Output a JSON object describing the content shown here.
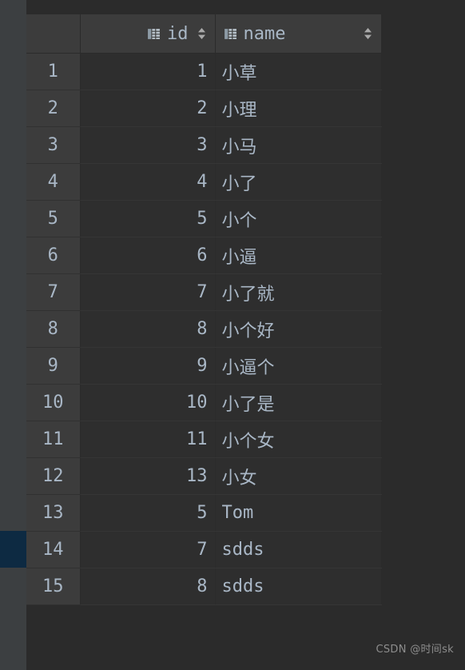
{
  "theme": {
    "window_bg": "#2b2b2b",
    "gutter_bg": "#3c3f41",
    "gutter_marker_bg": "#0d2a42",
    "header_bg": "#3c3c3c",
    "cell_bg": "#2e2e2e",
    "rownum_bg": "#3c3c3c",
    "text_color": "#a9b7c6",
    "grid_line": "#353535",
    "watermark_color": "#8d8d8d"
  },
  "table": {
    "columns": [
      {
        "key": "rownum",
        "label": "",
        "icon": "",
        "sortable": false,
        "align": "center"
      },
      {
        "key": "id",
        "label": "id",
        "icon": "table-column-icon",
        "sortable": true,
        "align": "right"
      },
      {
        "key": "name",
        "label": "name",
        "icon": "table-column-icon",
        "sortable": true,
        "align": "left"
      }
    ],
    "sort_icon": "sort-up-down-icon",
    "highlighted_row_index": 13,
    "rows": [
      {
        "rownum": "1",
        "id": "1",
        "name": "小草"
      },
      {
        "rownum": "2",
        "id": "2",
        "name": "小理"
      },
      {
        "rownum": "3",
        "id": "3",
        "name": "小马"
      },
      {
        "rownum": "4",
        "id": "4",
        "name": "小了"
      },
      {
        "rownum": "5",
        "id": "5",
        "name": "小个"
      },
      {
        "rownum": "6",
        "id": "6",
        "name": "小逼"
      },
      {
        "rownum": "7",
        "id": "7",
        "name": "小了就"
      },
      {
        "rownum": "8",
        "id": "8",
        "name": "小个好"
      },
      {
        "rownum": "9",
        "id": "9",
        "name": "小逼个"
      },
      {
        "rownum": "10",
        "id": "10",
        "name": "小了是"
      },
      {
        "rownum": "11",
        "id": "11",
        "name": "小个女"
      },
      {
        "rownum": "12",
        "id": "13",
        "name": "小女"
      },
      {
        "rownum": "13",
        "id": "5",
        "name": "Tom"
      },
      {
        "rownum": "14",
        "id": "7",
        "name": "sdds"
      },
      {
        "rownum": "15",
        "id": "8",
        "name": "sdds"
      }
    ]
  },
  "watermark": {
    "text": "CSDN @时间sk"
  }
}
